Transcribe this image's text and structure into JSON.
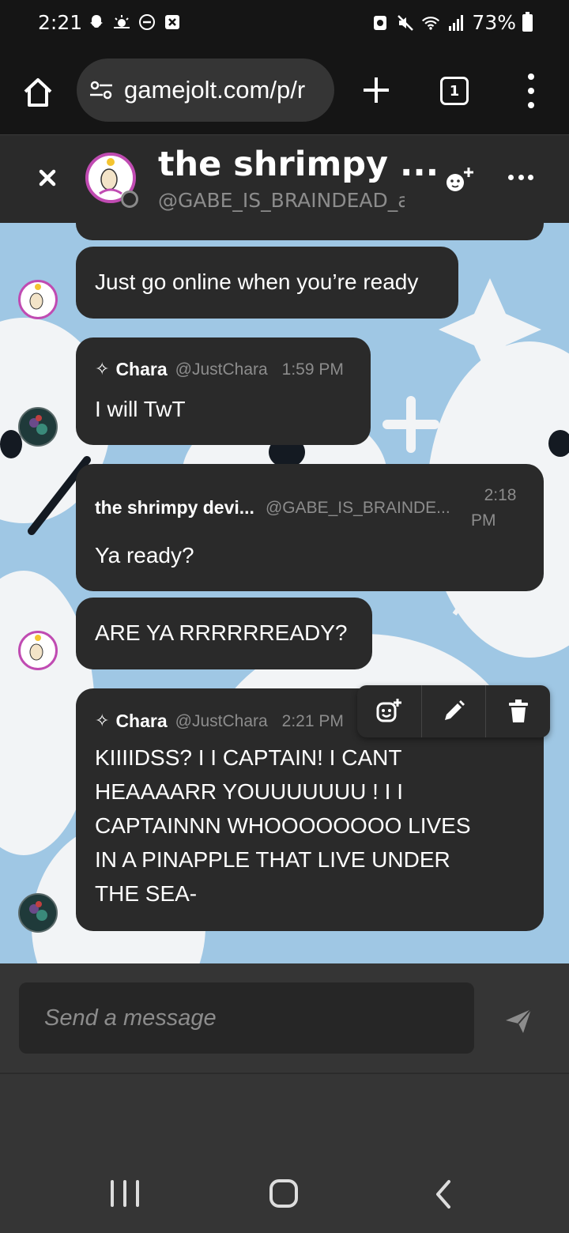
{
  "status_bar": {
    "time": "2:21",
    "battery": "73%"
  },
  "browser": {
    "url": "gamejolt.com/p/r",
    "tab_count": "1"
  },
  "chat_header": {
    "name": "the shrimpy ...",
    "handle": "@GABE_IS_BRAINDEAD_a"
  },
  "messages": [
    {
      "text": "Just go online when you’re ready"
    },
    {
      "sender": "Chara",
      "handle": "@JustChara",
      "time": "1:59 PM",
      "text": "I will TwT"
    },
    {
      "sender": "the shrimpy devi...",
      "handle": "@GABE_IS_BRAINDE...",
      "time_line1": "2:18",
      "time_line2": "PM",
      "text": "Ya ready?"
    },
    {
      "text": "ARE YA RRRRRREADY?"
    },
    {
      "sender": "Chara",
      "handle": "@JustChara",
      "time": "2:21 PM",
      "text_lines": [
        "KIIIIDSS? I I CAPTAIN! I CANT",
        "HEAAAARR YOUUUUUUU ! I I",
        "CAPTAINNN WHOOOOOOOO LIVES",
        "IN A PINAPPLE THAT LIVE UNDER",
        "THE SEA-"
      ]
    }
  ],
  "composer": {
    "placeholder": "Send a message"
  },
  "icons": {
    "home": "home-icon",
    "close": "close-icon",
    "add_friend": "add-friend-icon",
    "react": "add-reaction-icon",
    "edit": "pencil-icon",
    "delete": "trash-icon",
    "send": "send-icon"
  },
  "colors": {
    "bubble": "#2a2a2a",
    "avatar_ring": "#c04bb2",
    "chat_bg": "#9fc7e4",
    "muted_text": "#8c8c8c"
  }
}
